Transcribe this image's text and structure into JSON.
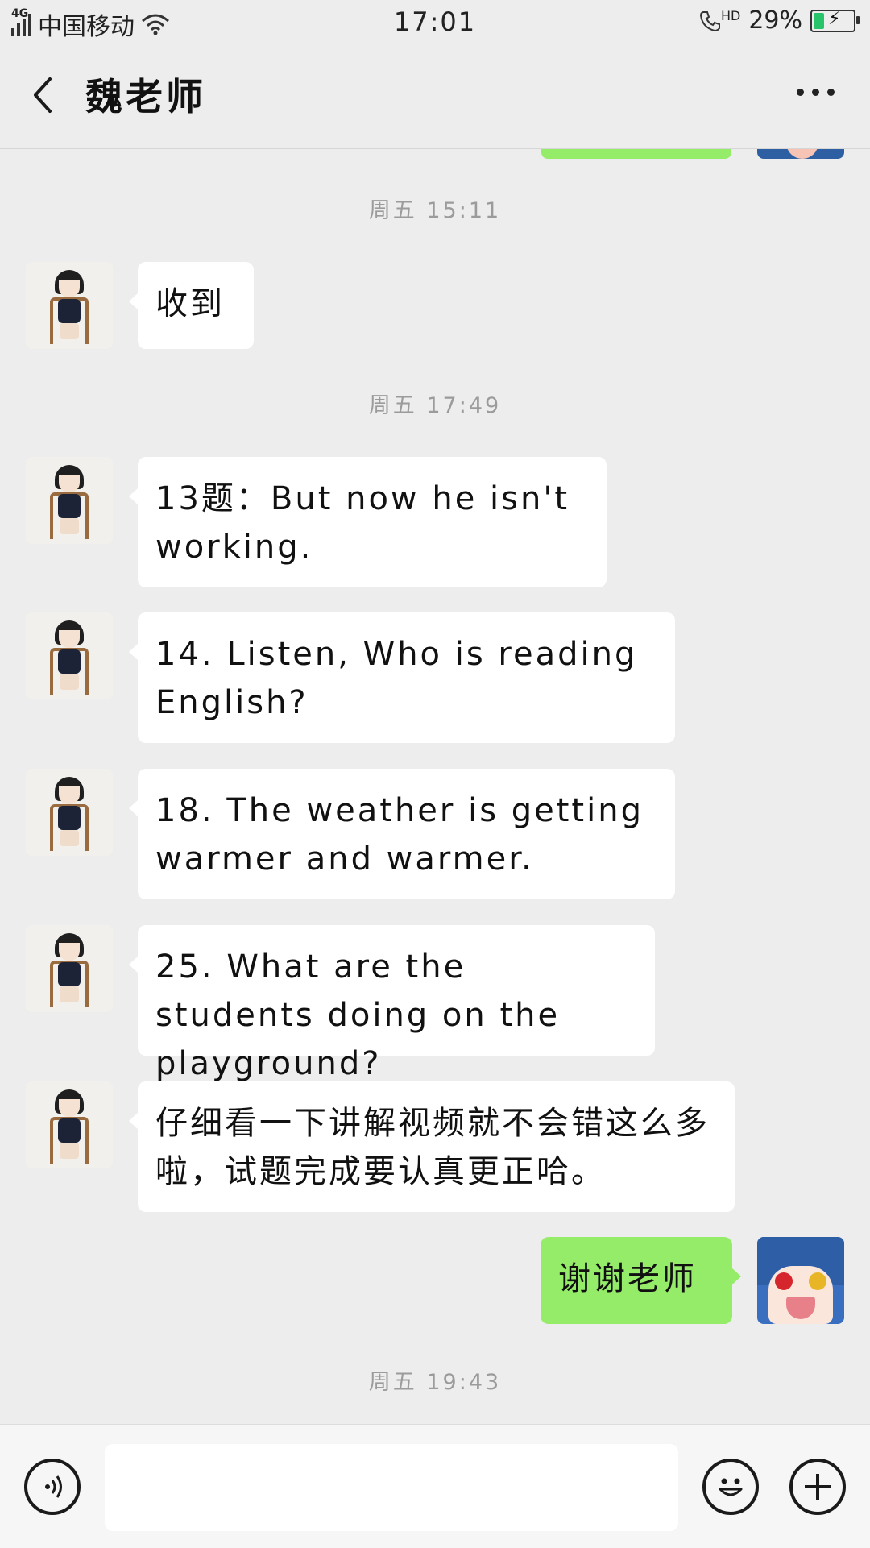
{
  "status_bar": {
    "network": "4G",
    "carrier": "中国移动",
    "time": "17:01",
    "hd_label": "HD",
    "battery_percent": "29%",
    "battery_level": 0.29
  },
  "header": {
    "title": "魏老师"
  },
  "messages": [
    {
      "type": "timestamp",
      "text": "周五 15:11"
    },
    {
      "type": "received",
      "text": "收到"
    },
    {
      "type": "timestamp",
      "text": "周五 17:49"
    },
    {
      "type": "received",
      "text": "13题：But now he isn't working."
    },
    {
      "type": "received",
      "text": "14. Listen, Who is reading English?"
    },
    {
      "type": "received",
      "text": "18. The weather is getting warmer and warmer."
    },
    {
      "type": "received",
      "text": "25. What are the students doing on the playground?"
    },
    {
      "type": "received",
      "text": "仔细看一下讲解视频就不会错这么多啦，试题完成要认真更正哈。"
    },
    {
      "type": "sent",
      "text": "谢谢老师"
    },
    {
      "type": "timestamp",
      "text": "周五 19:43"
    }
  ],
  "input_bar": {
    "value": "",
    "voice_icon": "voice-icon",
    "emoji_icon": "emoji-icon",
    "plus_icon": "plus-icon"
  },
  "colors": {
    "background": "#ededed",
    "sent_bubble": "#95ec69",
    "received_bubble": "#ffffff",
    "timestamp_text": "#9b9b9b"
  }
}
